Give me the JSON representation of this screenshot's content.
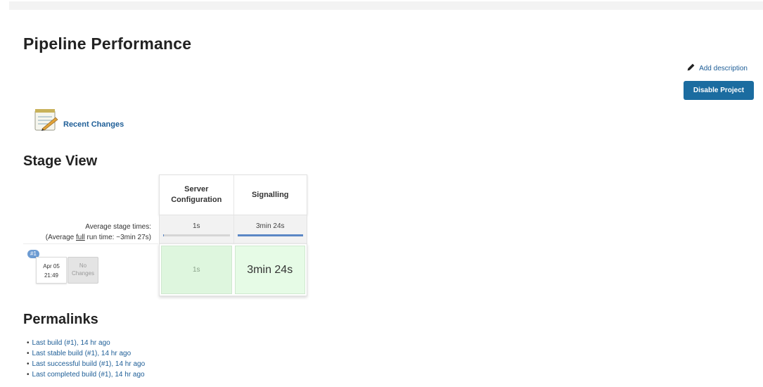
{
  "page": {
    "title": "Pipeline Performance",
    "add_description": "Add description",
    "disable_project": "Disable Project",
    "recent_changes": "Recent Changes"
  },
  "stage_view": {
    "title": "Stage View",
    "stages": [
      {
        "name_line1": "Server",
        "name_line2": "Configuration",
        "avg_time": "1s",
        "avg_fill": 0.01,
        "run_time": "1s"
      },
      {
        "name_line1": "Signalling",
        "name_line2": "",
        "avg_time": "3min 24s",
        "avg_fill": 1.0,
        "run_time": "3min 24s"
      }
    ],
    "avg_label": "Average stage times:",
    "avg_full_prefix": "(Average ",
    "avg_full_word": "full",
    "avg_full_suffix": " run time: ~3min 27s)",
    "build": {
      "badge": "#1",
      "date": "Apr 05",
      "time": "21:49",
      "no_changes_line1": "No",
      "no_changes_line2": "Changes"
    }
  },
  "permalinks": {
    "title": "Permalinks",
    "items": [
      "Last build (#1), 14 hr ago",
      "Last stable build (#1), 14 hr ago",
      "Last successful build (#1), 14 hr ago",
      "Last completed build (#1), 14 hr ago"
    ]
  },
  "colors": {
    "link": "#1e5e97",
    "button": "#1b6ca0",
    "success": "#def6de",
    "avg_bar": "#5b87c5"
  }
}
